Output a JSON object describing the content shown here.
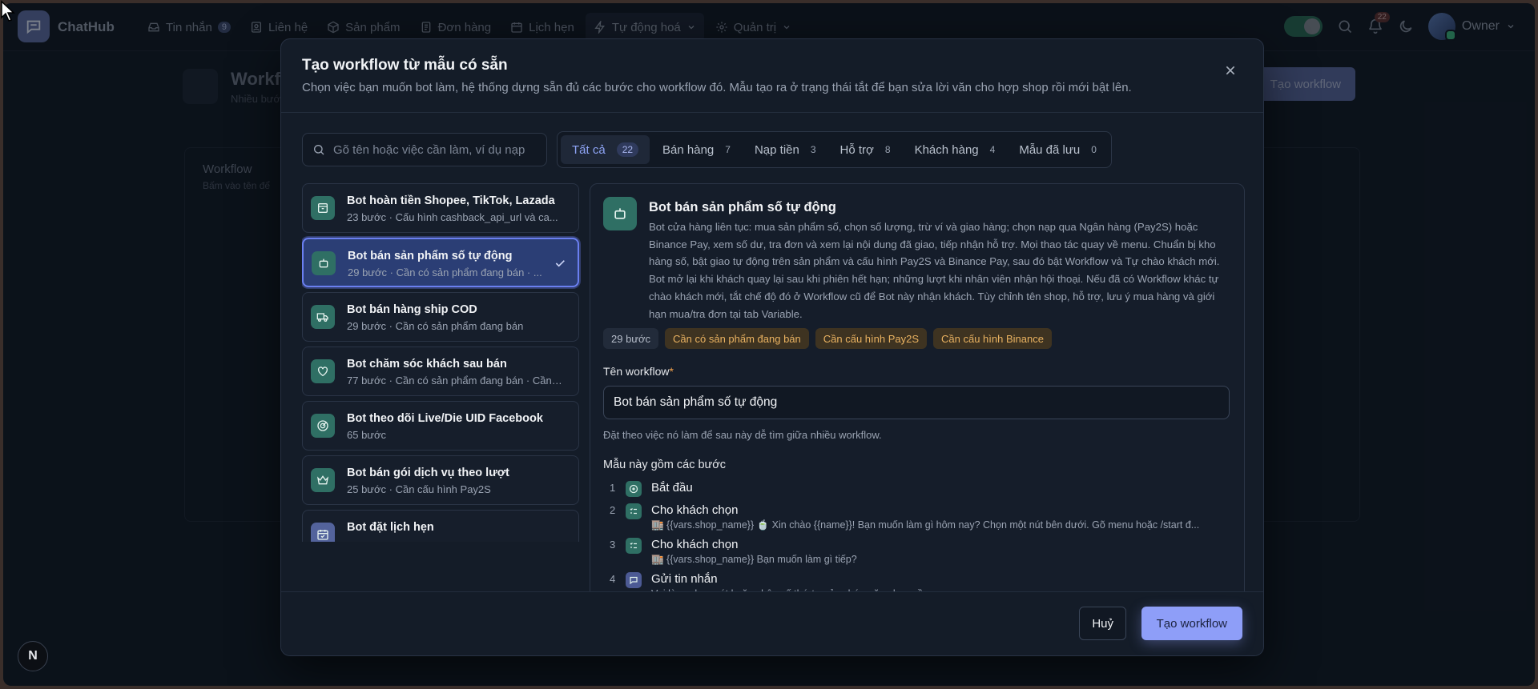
{
  "app": {
    "brand": "ChatHub"
  },
  "nav": {
    "items": [
      {
        "label": "Tin nhắn",
        "badge": "9"
      },
      {
        "label": "Liên hệ"
      },
      {
        "label": "Sản phẩm"
      },
      {
        "label": "Đơn hàng"
      },
      {
        "label": "Lịch hẹn"
      },
      {
        "label": "Tự động hoá"
      },
      {
        "label": "Quản trị"
      }
    ],
    "notification_count": "22",
    "user": "Owner"
  },
  "background": {
    "title": "Workfl",
    "subtitle": "Nhiều bước",
    "create_button": "Tạo workflow",
    "card_title": "Workflow",
    "card_subtitle": "Bấm vào tên để"
  },
  "modal": {
    "title": "Tạo workflow từ mẫu có sẵn",
    "description": "Chọn việc bạn muốn bot làm, hệ thống dựng sẵn đủ các bước cho workflow đó. Mẫu tạo ra ở trạng thái tắt để bạn sửa lời văn cho hợp shop rồi mới bật lên.",
    "search_placeholder": "Gõ tên hoặc việc cần làm, ví dụ nạp",
    "tabs": [
      {
        "label": "Tất cả",
        "count": "22"
      },
      {
        "label": "Bán hàng",
        "count": "7"
      },
      {
        "label": "Nạp tiền",
        "count": "3"
      },
      {
        "label": "Hỗ trợ",
        "count": "8"
      },
      {
        "label": "Khách hàng",
        "count": "4"
      },
      {
        "label": "Mẫu đã lưu",
        "count": "0"
      }
    ],
    "templates": [
      {
        "title": "Bot hoàn tiền Shopee, TikTok, Lazada",
        "subtitle": "23 bước · Cấu hình cashback_api_url và ca..."
      },
      {
        "title": "Bot bán sản phẩm số tự động",
        "subtitle": "29 bước · Cần có sản phẩm đang bán · ..."
      },
      {
        "title": "Bot bán hàng ship COD",
        "subtitle": "29 bước · Cần có sản phẩm đang bán"
      },
      {
        "title": "Bot chăm sóc khách sau bán",
        "subtitle": "77 bước · Cần có sản phẩm đang bán · Cần ..."
      },
      {
        "title": "Bot theo dõi Live/Die UID Facebook",
        "subtitle": "65 bước"
      },
      {
        "title": "Bot bán gói dịch vụ theo lượt",
        "subtitle": "25 bước · Cần cấu hình Pay2S"
      },
      {
        "title": "Bot đặt lịch hẹn",
        "subtitle": ""
      }
    ],
    "detail": {
      "title": "Bot bán sản phẩm số tự động",
      "description": "Bot cửa hàng liên tục: mua sản phẩm số, chọn số lượng, trừ ví và giao hàng; chọn nạp qua Ngân hàng (Pay2S) hoặc Binance Pay, xem số dư, tra đơn và xem lại nội dung đã giao, tiếp nhận hỗ trợ. Mọi thao tác quay về menu. Chuẩn bị kho hàng số, bật giao tự động trên sản phẩm và cấu hình Pay2S và Binance Pay, sau đó bật Workflow và Tự chào khách mới. Bot mở lại khi khách quay lại sau khi phiên hết hạn; những lượt khi nhân viên nhận hội thoại. Nếu đã có Workflow khác tự chào khách mới, tắt chế độ đó ở Workflow cũ để Bot này nhận khách. Tùy chỉnh tên shop, hỗ trợ, lưu ý mua hàng và giới hạn mua/tra đơn tại tab Variable.",
      "tags": [
        "29 bước",
        "Cần có sản phẩm đang bán",
        "Cần cấu hình Pay2S",
        "Cần cấu hình Binance"
      ],
      "name_label": "Tên workflow",
      "name_value": "Bot bán sản phẩm số tự động",
      "name_hint": "Đặt theo việc nó làm để sau này dễ tìm giữa nhiều workflow.",
      "steps_label": "Mẫu này gồm các bước",
      "steps": [
        {
          "num": "1",
          "title": "Bắt đầu",
          "sub": ""
        },
        {
          "num": "2",
          "title": "Cho khách chọn",
          "sub": "🏬 {{vars.shop_name}} 🍵 Xin chào {{name}}! Bạn muốn làm gì hôm nay? Chọn một nút bên dưới. Gõ menu hoặc /start đ..."
        },
        {
          "num": "3",
          "title": "Cho khách chọn",
          "sub": "🏬 {{vars.shop_name}} Bạn muốn làm gì tiếp?"
        },
        {
          "num": "4",
          "title": "Gửi tin nhắn",
          "sub": "Vui lòng chọn nút hoặc nhập số thứ tự của chức năng bạn cần."
        }
      ]
    },
    "cancel_label": "Huỷ",
    "create_label": "Tạo workflow"
  },
  "devtools": {
    "label": "N"
  },
  "colors": {
    "accent": "#8e9ef8",
    "selected": "#2b3e75",
    "teal": "#2f6f64",
    "warn": "#e9b261"
  }
}
